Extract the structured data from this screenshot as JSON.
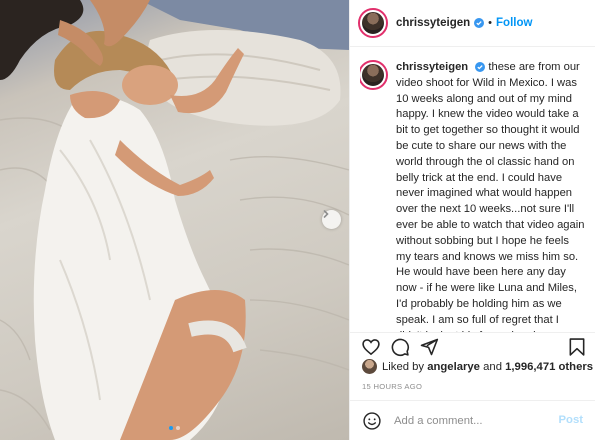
{
  "post_header": {
    "username": "chrissyteigen",
    "separator": "•",
    "follow_label": "Follow"
  },
  "caption": {
    "username": "chrissyteigen",
    "text": "these are from our video shoot for Wild in Mexico. I was 10 weeks along and out of my mind happy. I knew the video would take a bit to get together so thought it would be cute to share our news with the world through the ol classic hand on belly trick at the end. I could have never imagined what would happen over the next 10 weeks...not sure I'll ever be able to watch that video again without sobbing but I hope he feels my tears and knows we miss him so. He would have been here any day now - if he were like Luna and Miles, I'd probably be holding him as we speak. I am so full of regret that I didn't look at his face when he was born. I was so scared of seeing him"
  },
  "likes": {
    "prefix": "Liked by",
    "user": "angelarye",
    "conjunction": "and",
    "count": "1,996,471 others"
  },
  "timestamp": "15 HOURS AGO",
  "comment_box": {
    "placeholder": "Add a comment...",
    "post_label": "Post"
  },
  "carousel": {
    "slide_count": 2,
    "active_slide": 1
  },
  "colors": {
    "verified": "#3897f0",
    "follow": "#0095f6",
    "post_disabled": "#b2dffc",
    "story_ring": "#e1306c"
  },
  "icons": [
    "heart-icon",
    "comment-icon",
    "share-icon",
    "bookmark-icon",
    "smiley-icon",
    "verified-badge-icon",
    "chevron-right-icon"
  ]
}
